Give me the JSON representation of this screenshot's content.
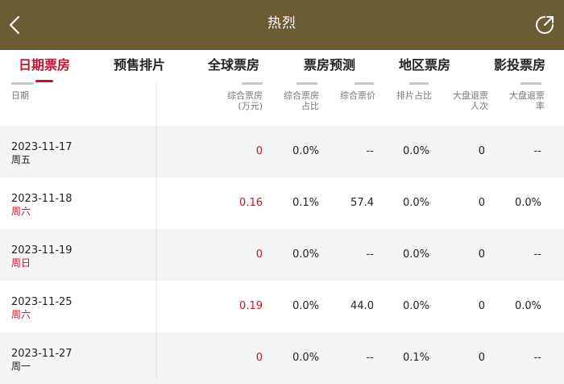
{
  "nav": {
    "title": "热烈",
    "back_icon": "chevron-left-icon",
    "share_icon": "share-arrow-icon",
    "bg_color": "#6b5c34"
  },
  "tabs": [
    {
      "label": "日期票房",
      "active": true
    },
    {
      "label": "预售排片",
      "active": false
    },
    {
      "label": "全球票房",
      "active": false
    },
    {
      "label": "票房预测",
      "active": false
    },
    {
      "label": "地区票房",
      "active": false
    },
    {
      "label": "影投票房",
      "active": false
    }
  ],
  "accent_color": "#c8102e",
  "table": {
    "headers": {
      "date": "日期",
      "box_office_line1": "综合票房",
      "box_office_line2": "(万元)",
      "share_line1": "综合票房",
      "share_line2": "占比",
      "avg_price": "综合票价",
      "screening_share": "排片占比",
      "refund_line1": "大盘退票",
      "refund_line2": "人次",
      "refund_rate_line1": "大盘退票",
      "refund_rate_line2": "率"
    },
    "rows": [
      {
        "date": "2023-11-17",
        "weekday": "周五",
        "weekend": false,
        "box_office": "0",
        "share": "0.0%",
        "avg_price": "--",
        "screening_share": "0.0%",
        "refund_count": "0",
        "refund_rate": "--"
      },
      {
        "date": "2023-11-18",
        "weekday": "周六",
        "weekend": true,
        "box_office": "0.16",
        "share": "0.1%",
        "avg_price": "57.4",
        "screening_share": "0.0%",
        "refund_count": "0",
        "refund_rate": "0.0%"
      },
      {
        "date": "2023-11-19",
        "weekday": "周日",
        "weekend": true,
        "box_office": "0",
        "share": "0.0%",
        "avg_price": "--",
        "screening_share": "0.0%",
        "refund_count": "0",
        "refund_rate": "--"
      },
      {
        "date": "2023-11-25",
        "weekday": "周六",
        "weekend": true,
        "box_office": "0.19",
        "share": "0.0%",
        "avg_price": "44.0",
        "screening_share": "0.0%",
        "refund_count": "0",
        "refund_rate": "0.0%"
      },
      {
        "date": "2023-11-27",
        "weekday": "周一",
        "weekend": false,
        "box_office": "0",
        "share": "0.0%",
        "avg_price": "--",
        "screening_share": "0.1%",
        "refund_count": "0",
        "refund_rate": "--"
      }
    ]
  }
}
